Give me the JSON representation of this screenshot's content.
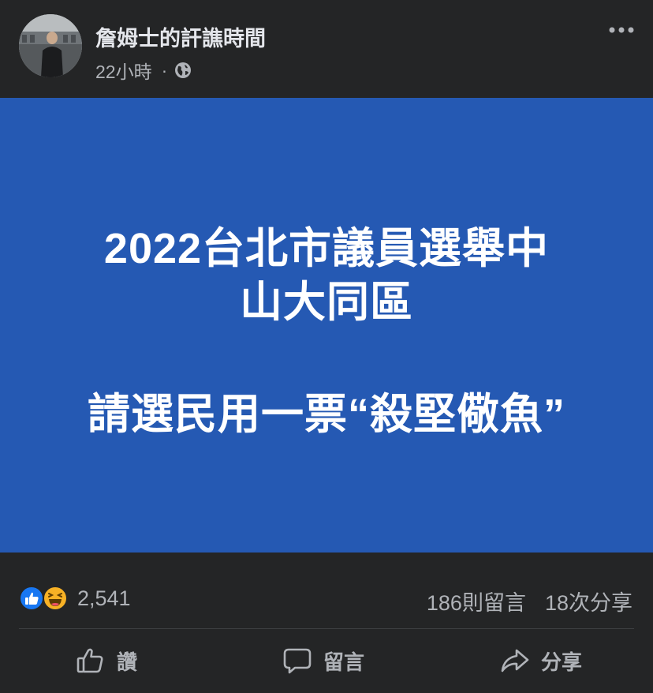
{
  "header": {
    "page_name": "詹姆士的訐譙時間",
    "timestamp": "22小時",
    "separator": "·",
    "audience_icon": "globe-icon",
    "more_icon": "more-options-icon"
  },
  "post_image": {
    "background": "#2559b3",
    "lines": [
      "2022台北市議員選舉中",
      "山大同區",
      "請選民用一票“殺堅儆魚”"
    ]
  },
  "stats": {
    "reaction_icons": [
      "like-reaction-icon",
      "haha-reaction-icon"
    ],
    "reaction_count": "2,541",
    "comments": "186則留言",
    "shares": "18次分享"
  },
  "actions": {
    "like_label": "讚",
    "comment_label": "留言",
    "share_label": "分享"
  },
  "colors": {
    "surface": "#242526",
    "text_primary": "#e4e6eb",
    "text_secondary": "#b0b3b8",
    "like_blue": "#1877f2",
    "haha_yellow": "#f7b125"
  }
}
